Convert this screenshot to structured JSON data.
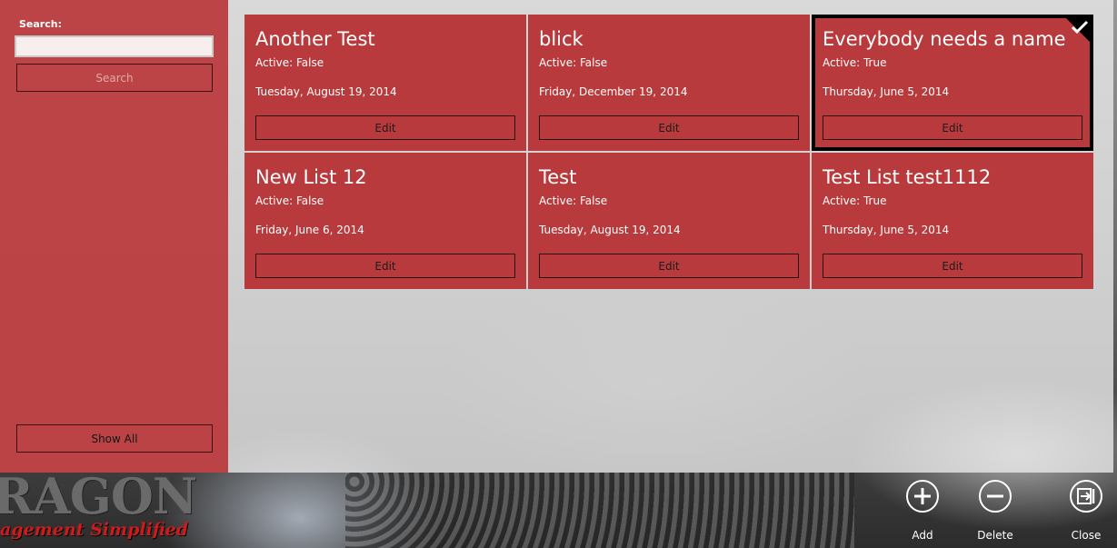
{
  "sidebar": {
    "search_label": "Search:",
    "search_value": "",
    "search_button": "Search",
    "show_all_button": "Show All"
  },
  "tiles": [
    {
      "title": "Another Test",
      "active": "Active: False",
      "date": "Tuesday, August 19, 2014",
      "edit": "Edit",
      "selected": false
    },
    {
      "title": "blick",
      "active": "Active: False",
      "date": "Friday, December 19, 2014",
      "edit": "Edit",
      "selected": false
    },
    {
      "title": "Everybody needs a name",
      "active": "Active: True",
      "date": "Thursday, June 5, 2014",
      "edit": "Edit",
      "selected": true
    },
    {
      "title": "New List 12",
      "active": "Active: False",
      "date": "Friday, June 6, 2014",
      "edit": "Edit",
      "selected": false
    },
    {
      "title": "Test",
      "active": "Active: False",
      "date": "Tuesday, August 19, 2014",
      "edit": "Edit",
      "selected": false
    },
    {
      "title": "Test List test1112",
      "active": "Active: True",
      "date": "Thursday, June 5, 2014",
      "edit": "Edit",
      "selected": false
    }
  ],
  "brand": {
    "big_text": "RAGON",
    "tagline": "agement Simplified"
  },
  "appbar": {
    "add_label": "Add",
    "add_icon": "plus-circle-icon",
    "delete_label": "Delete",
    "delete_icon": "minus-circle-icon",
    "close_label": "Close",
    "close_icon": "exit-icon"
  },
  "colors": {
    "accent": "#b83a3c",
    "selected_border": "#000000"
  }
}
